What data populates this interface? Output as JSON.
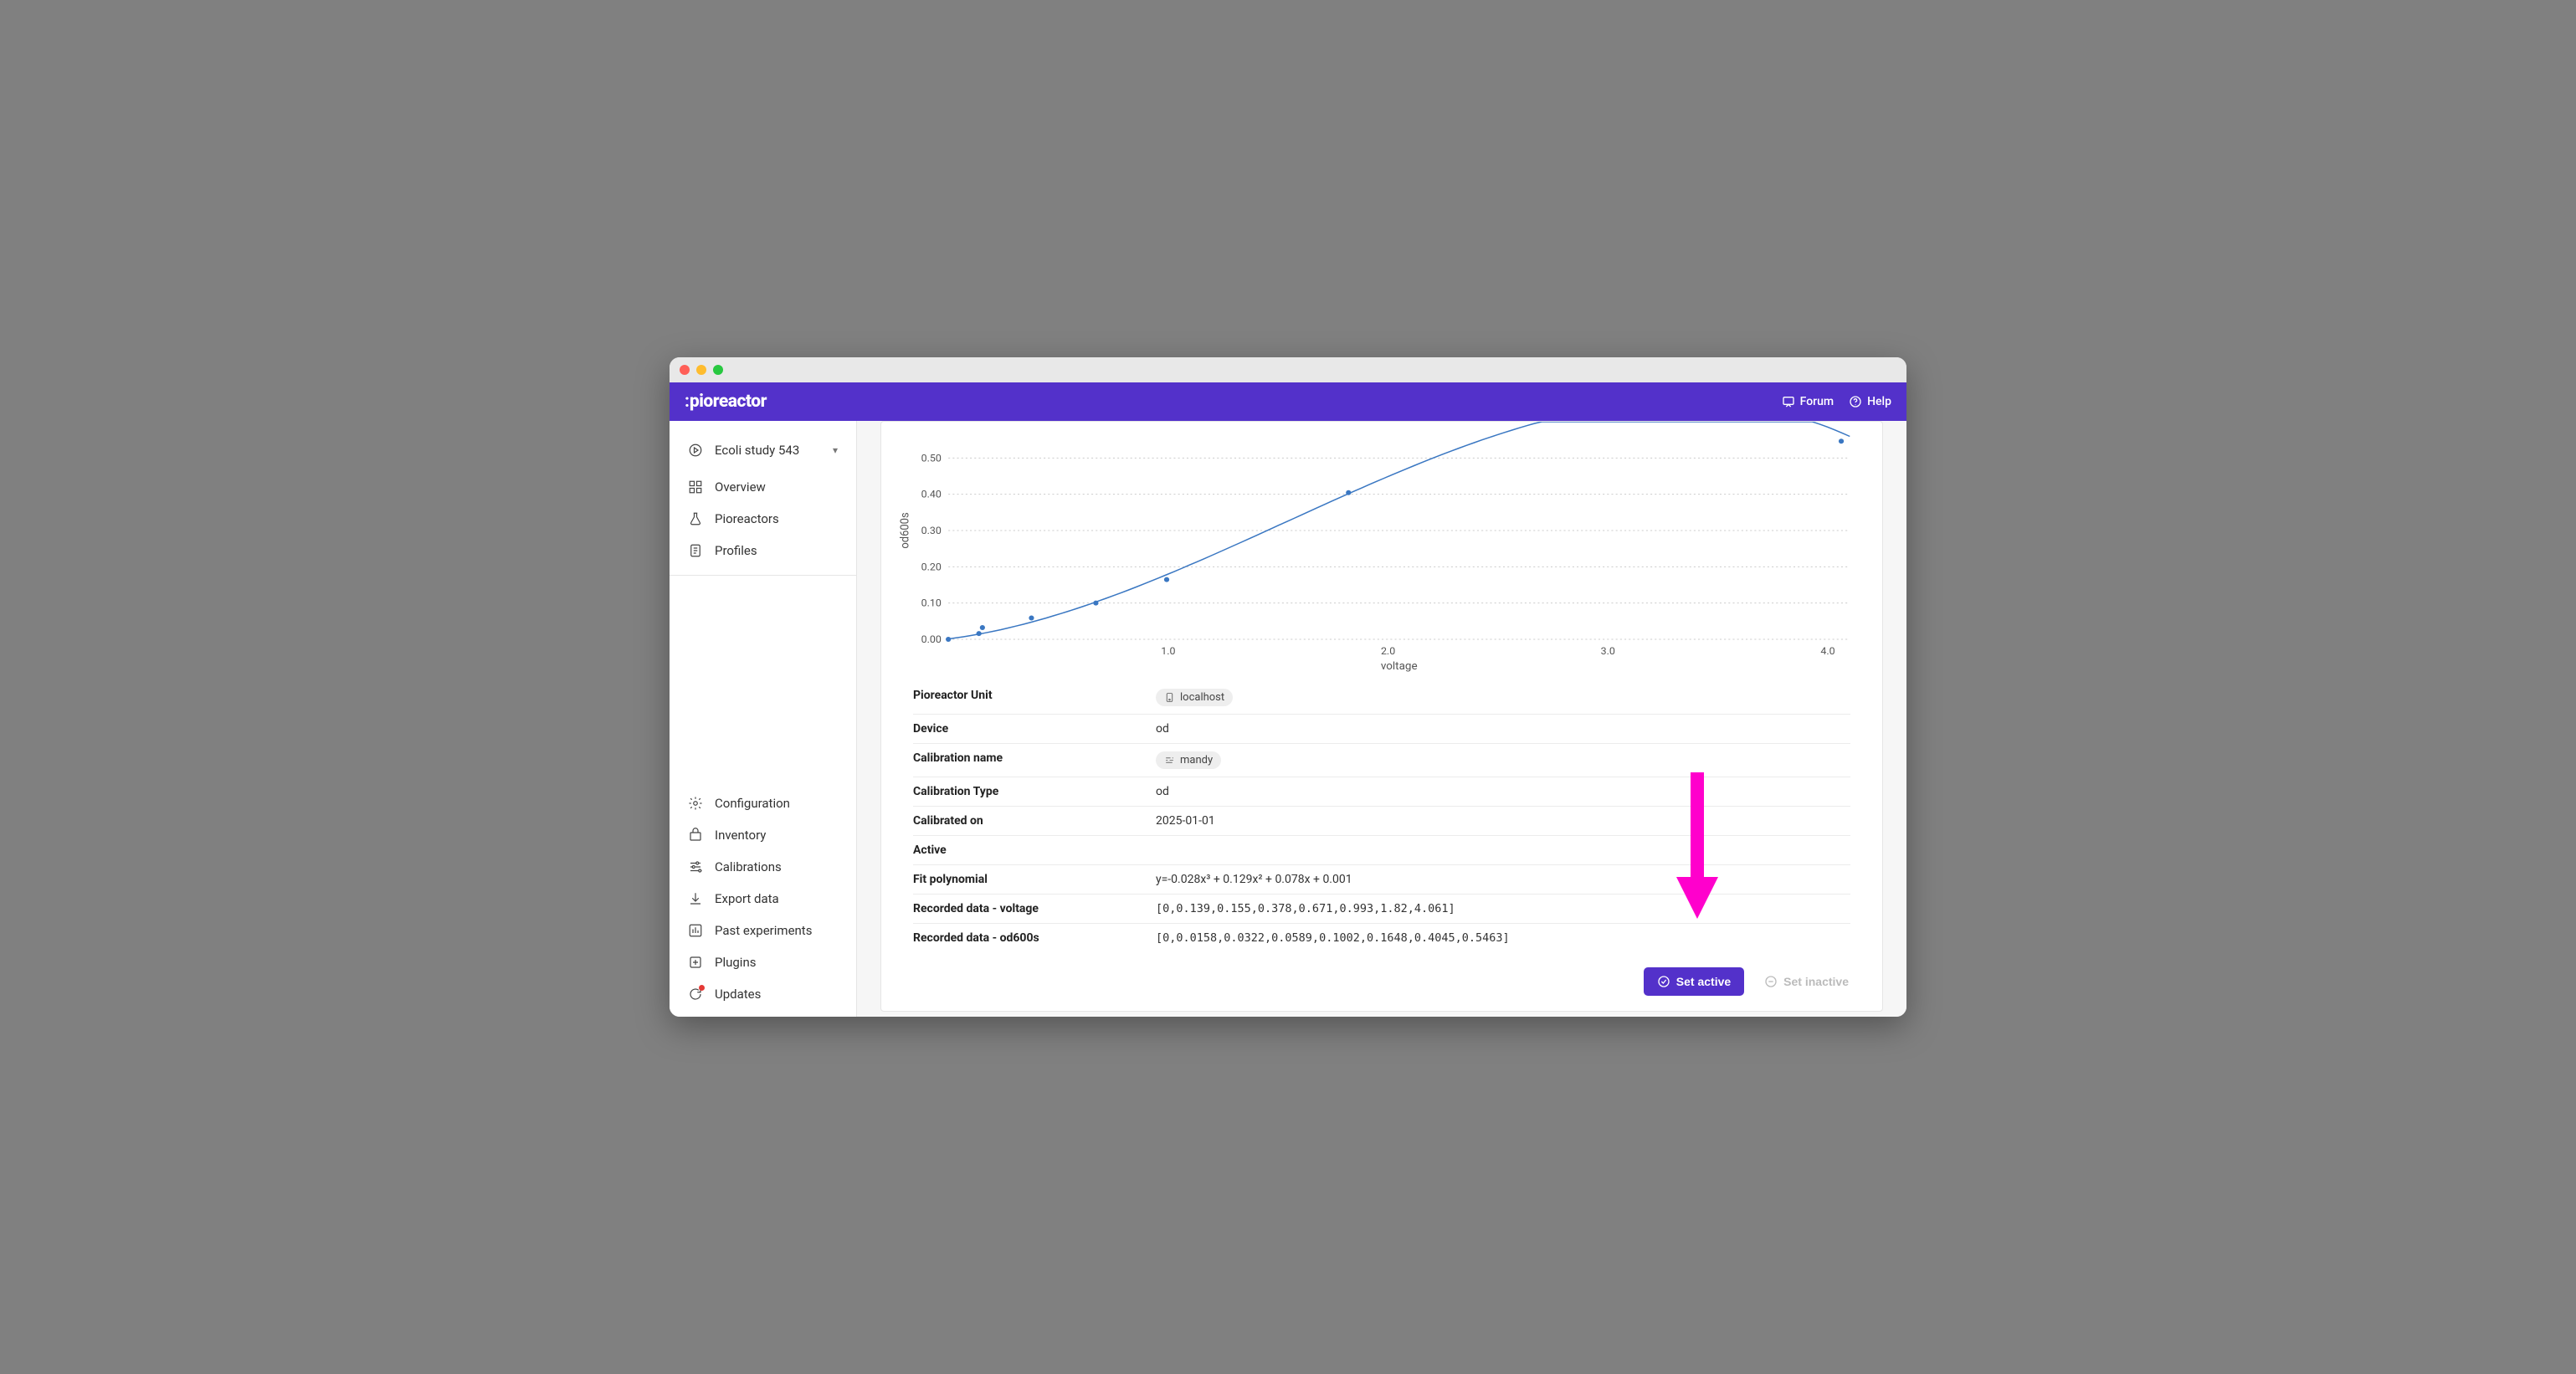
{
  "brand": "pioreactor",
  "topbar": {
    "forum": "Forum",
    "help": "Help"
  },
  "sidebar": {
    "experiment": "Ecoli study 543",
    "overview": "Overview",
    "pioreactors": "Pioreactors",
    "profiles": "Profiles",
    "configuration": "Configuration",
    "inventory": "Inventory",
    "calibrations": "Calibrations",
    "export": "Export data",
    "past": "Past experiments",
    "plugins": "Plugins",
    "updates": "Updates"
  },
  "chart_data": {
    "type": "scatter",
    "xlabel": "voltage",
    "ylabel": "od600s",
    "xlim": [
      0,
      4.1
    ],
    "ylim": [
      0,
      0.6
    ],
    "x": [
      0,
      0.139,
      0.155,
      0.378,
      0.671,
      0.993,
      1.82,
      4.061
    ],
    "y": [
      0,
      0.0158,
      0.0322,
      0.0589,
      0.1002,
      0.1648,
      0.4045,
      0.5463
    ],
    "y_ticks": [
      0.0,
      0.1,
      0.2,
      0.3,
      0.4,
      0.5
    ],
    "x_ticks": [
      1.0,
      2.0,
      3.0,
      4.0
    ],
    "fit": {
      "a": -0.028,
      "b": 0.129,
      "c": 0.078,
      "d": 0.001
    }
  },
  "details": {
    "labels": {
      "unit": "Pioreactor Unit",
      "device": "Device",
      "calib_name": "Calibration name",
      "calib_type": "Calibration Type",
      "calib_on": "Calibrated on",
      "active": "Active",
      "fit": "Fit polynomial",
      "rec_v": "Recorded data - voltage",
      "rec_od": "Recorded data - od600s"
    },
    "unit": "localhost",
    "device": "od",
    "calib_name": "mandy",
    "calib_type": "od",
    "calib_on": "2025-01-01",
    "active": "",
    "fit": "y=-0.028x³ + 0.129x² + 0.078x + 0.001",
    "rec_v": "[0,0.139,0.155,0.378,0.671,0.993,1.82,4.061]",
    "rec_od": "[0,0.0158,0.0322,0.0589,0.1002,0.1648,0.4045,0.5463]"
  },
  "actions": {
    "set_active": "Set active",
    "set_inactive": "Set inactive"
  }
}
